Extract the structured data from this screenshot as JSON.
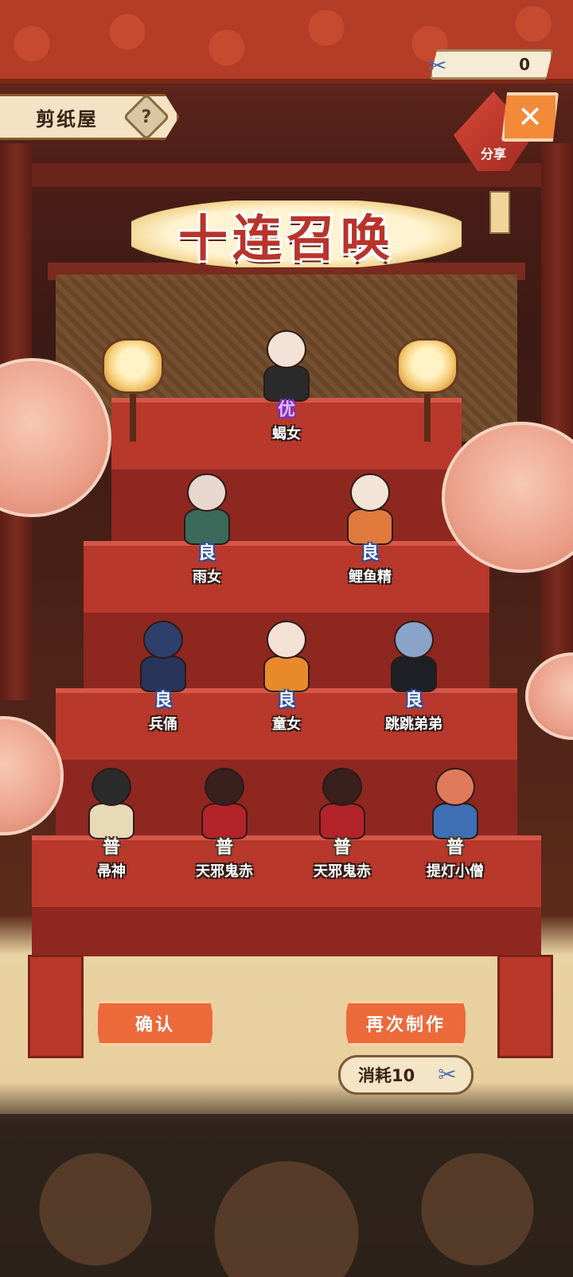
{
  "header": {
    "title": "剪纸屋",
    "help_symbol": "?",
    "currency_value": "0",
    "currency_icon": "paper-doll-icon",
    "close_symbol": "✕",
    "share_label": "分享"
  },
  "banner": {
    "title": "十连召唤"
  },
  "characters": [
    {
      "name": "蝎女",
      "rarity": "优",
      "head": "#f3e2d5",
      "body": "#2b2b2b"
    },
    {
      "name": "雨女",
      "rarity": "良",
      "head": "#e8d7cc",
      "body": "#3b6a5a"
    },
    {
      "name": "鲤鱼精",
      "rarity": "良",
      "head": "#f4e4d8",
      "body": "#e07a3c"
    },
    {
      "name": "兵俑",
      "rarity": "良",
      "head": "#2f3f6b",
      "body": "#28345a"
    },
    {
      "name": "童女",
      "rarity": "良",
      "head": "#f2e1d4",
      "body": "#e98a2a"
    },
    {
      "name": "跳跳弟弟",
      "rarity": "良",
      "head": "#8aa3c8",
      "body": "#1f1f26"
    },
    {
      "name": "帚神",
      "rarity": "普",
      "head": "#2b2b2b",
      "body": "#e8d9b7"
    },
    {
      "name": "天邪鬼赤",
      "rarity": "普",
      "head": "#3a1f1f",
      "body": "#b3232a"
    },
    {
      "name": "天邪鬼赤",
      "rarity": "普",
      "head": "#3a1f1f",
      "body": "#b3232a"
    },
    {
      "name": "提灯小僧",
      "rarity": "普",
      "head": "#e07a5c",
      "body": "#3f6fb5"
    }
  ],
  "actions": {
    "confirm_label": "确认",
    "again_label": "再次制作",
    "cost_label": "消耗10",
    "cost_icon": "paper-doll-icon"
  },
  "colors": {
    "accent": "#ec6a3a",
    "stair_red": "#b8382b",
    "rarity_good": "#2b4f9e",
    "rarity_excellent": "#7a2fb5"
  }
}
